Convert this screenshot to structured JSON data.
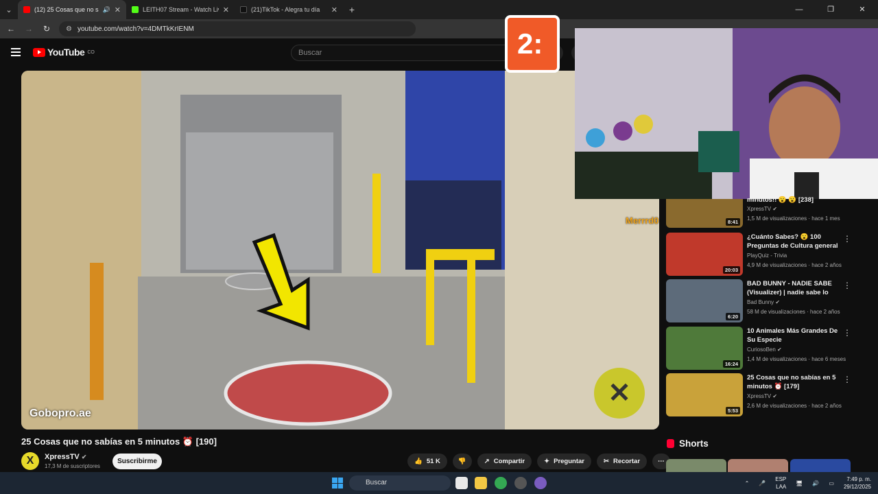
{
  "browser": {
    "tabs": [
      {
        "title": "(12) 25 Cosas que no sabías",
        "favicon_color": "#ff0000",
        "active": true
      },
      {
        "title": "LEITH07 Stream - Watch Live o",
        "favicon_color": "#53fc18",
        "active": false
      },
      {
        "title": "(21)TikTok - Alegra tu día",
        "favicon_color": "#111111",
        "active": false
      }
    ],
    "new_tab_icon": "plus-icon",
    "url": "youtube.com/watch?v=4DMTkKrIENM"
  },
  "youtube": {
    "logo_text": "YouTube",
    "country_code": "CO",
    "search_placeholder": "Buscar"
  },
  "player": {
    "watermark": "Gobopro.ae",
    "timer_text": "2:",
    "streamer_tag": "Merrrd0"
  },
  "video": {
    "title": "25 Cosas que no sabías en 5 minutos ⏰ [190]",
    "channel": "XpressTV",
    "channel_avatar": "X",
    "subscribers": "17,3 M de suscriptores",
    "subscribe_label": "Suscribirme",
    "likes": "51 K",
    "share_label": "Compartir",
    "ask_label": "Preguntar",
    "clip_label": "Recortar"
  },
  "recommendations": [
    {
      "title": "minutos!! 😮 😮 [238]",
      "channel": "XpressTV",
      "verified": true,
      "meta": "1,5 M de visualizaciones · hace 1 mes",
      "duration": "8:41",
      "color": "#8a6a2e"
    },
    {
      "title": "¿Cuánto Sabes? 😮 100 Preguntas de Cultura general ...",
      "channel": "PlayQuiz - Trivia",
      "verified": false,
      "meta": "4,9 M de visualizaciones · hace 2 años",
      "duration": "20:03",
      "color": "#c0392b"
    },
    {
      "title": "BAD BUNNY -  NADIE SABE (Visualizer) | nadie sabe lo que...",
      "channel": "Bad Bunny",
      "verified": true,
      "meta": "58 M de visualizaciones · hace 2 años",
      "duration": "6:20",
      "color": "#5d6b7a"
    },
    {
      "title": "10 Animales Más Grandes De Su Especie",
      "channel": "CuriosoBen",
      "verified": true,
      "meta": "1,4 M de visualizaciones · hace 6 meses",
      "duration": "16:24",
      "color": "#4f7a3a"
    },
    {
      "title": "25 Cosas que no sabías en 5 minutos ⏰ [179]",
      "channel": "XpressTV",
      "verified": true,
      "meta": "2,6 M de visualizaciones · hace 2 años",
      "duration": "5:53",
      "color": "#c9a23a"
    }
  ],
  "shorts_label": "Shorts",
  "taskbar": {
    "search_placeholder": "Buscar",
    "language": "ESP",
    "language_sub": "LAA",
    "time": "7:49 p. m.",
    "date": "29/12/2025"
  }
}
